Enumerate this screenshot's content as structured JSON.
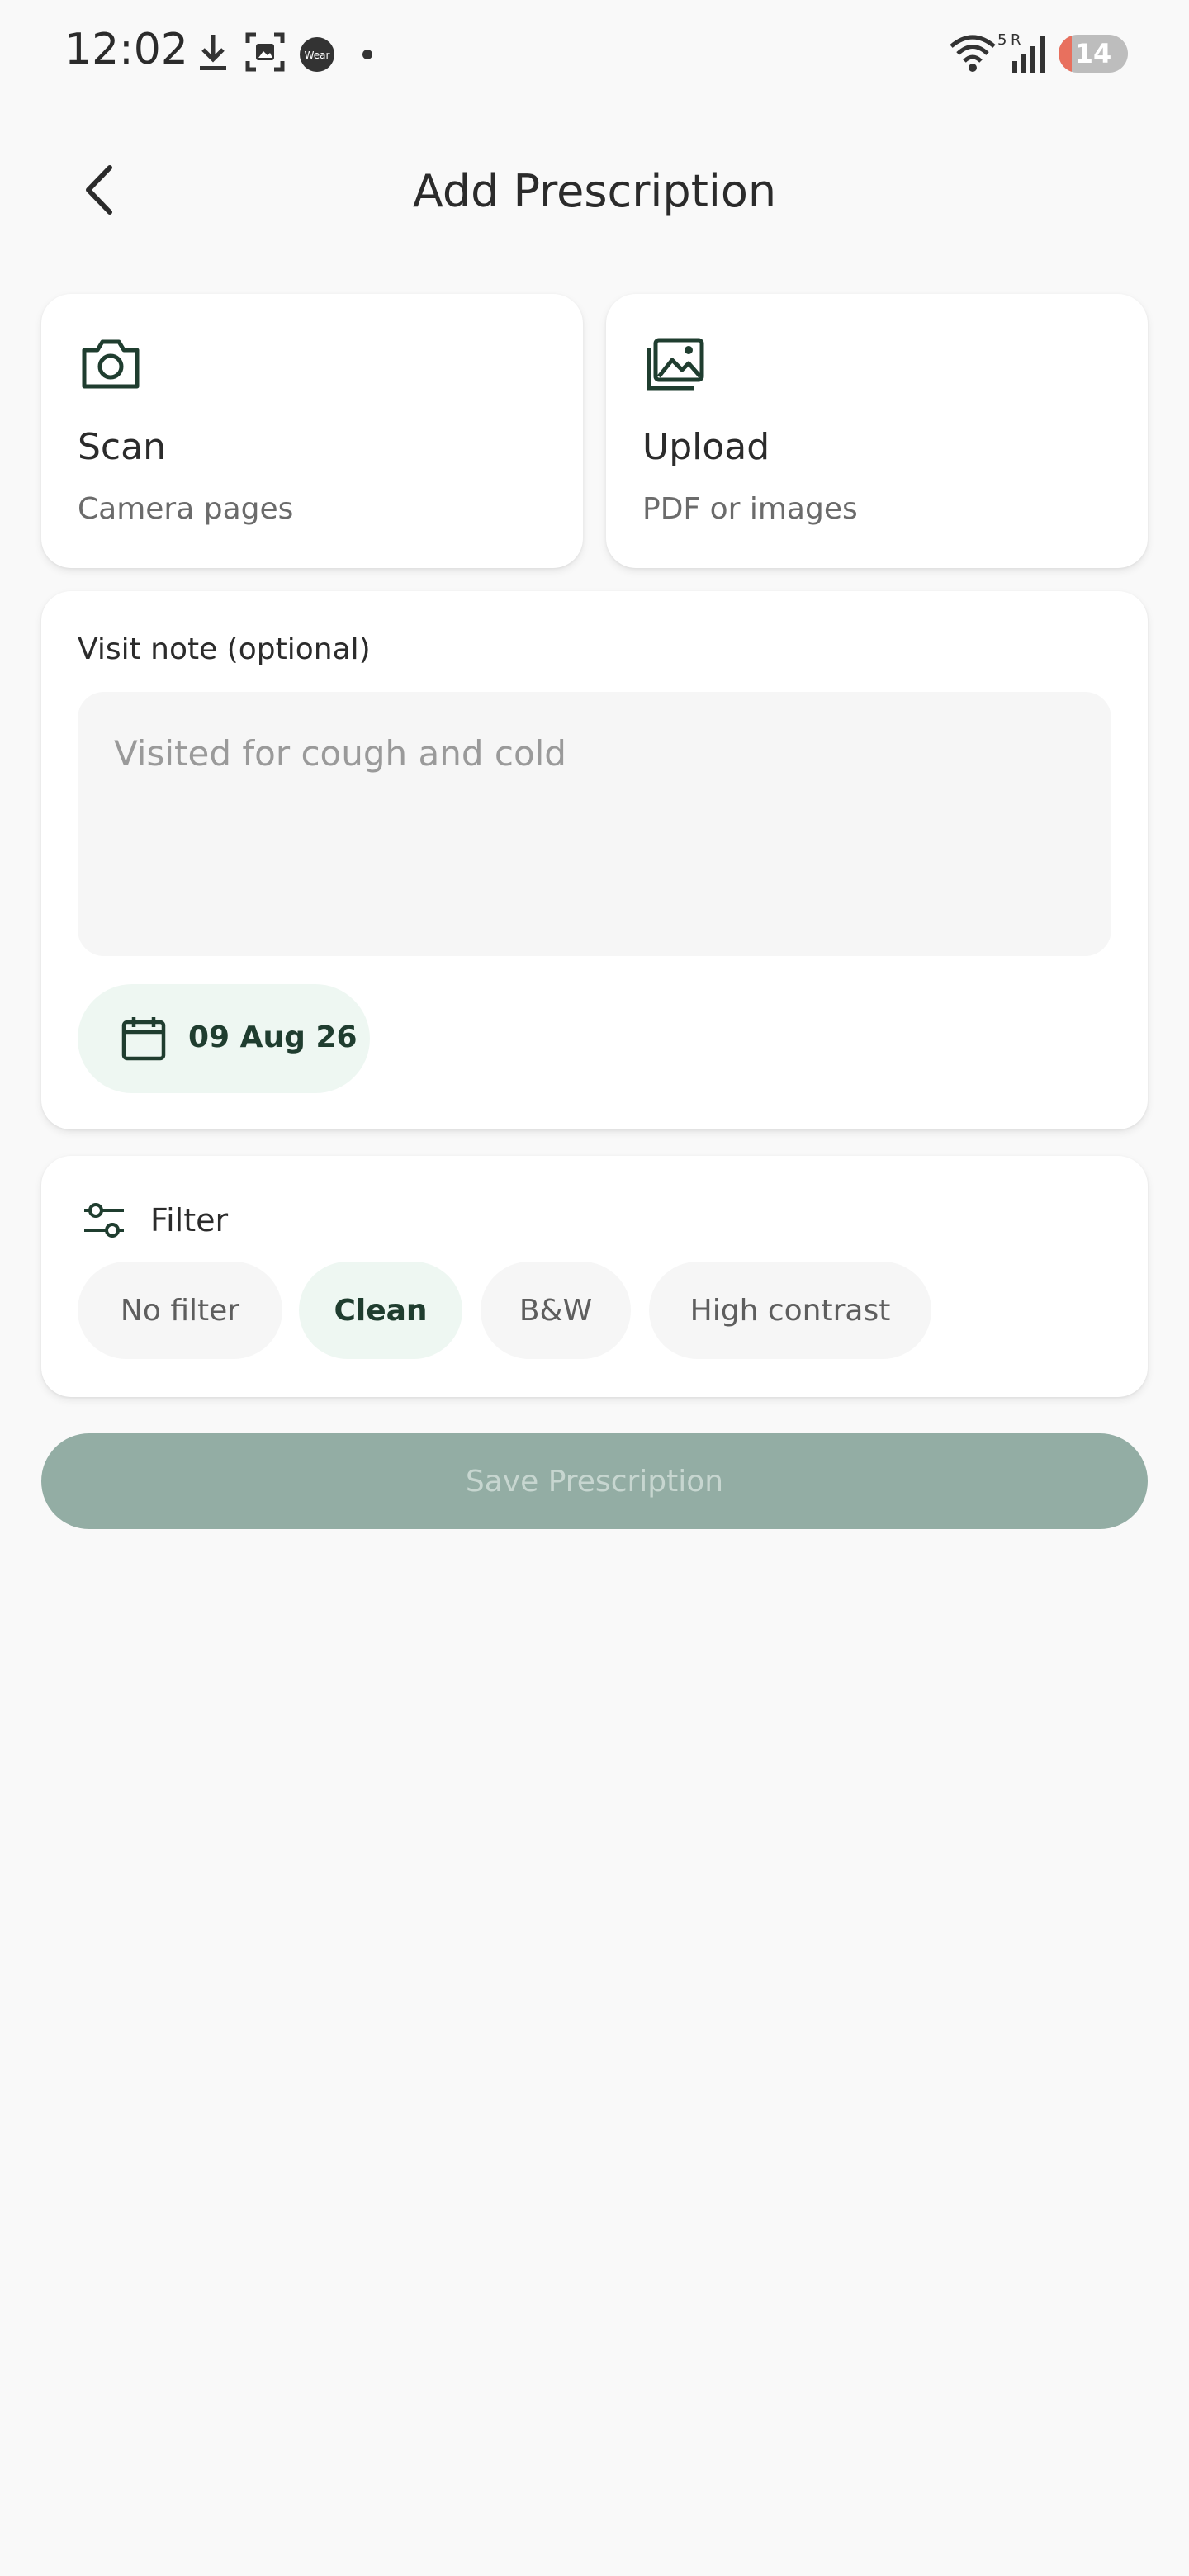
{
  "status_bar": {
    "time": "12:02",
    "icons": [
      "download-icon",
      "screenshot-icon",
      "wear-icon",
      "dot-icon",
      "wifi-icon",
      "signal-icon",
      "battery-icon"
    ],
    "wear_label": "Wear",
    "wifi_label": "5",
    "roaming_label": "R",
    "battery": "14"
  },
  "header": {
    "title": "Add Prescription",
    "back_icon": "back-arrow-icon"
  },
  "sources": [
    {
      "title": "Scan",
      "subtitle": "Camera pages",
      "icon": "camera-icon"
    },
    {
      "title": "Upload",
      "subtitle": "PDF or images",
      "icon": "gallery-icon"
    }
  ],
  "note": {
    "label": "Visit note (optional)",
    "placeholder": "Visited for cough and cold",
    "value": "",
    "date": "09 Aug 26",
    "date_icon": "calendar-icon"
  },
  "filter": {
    "label": "Filter",
    "icon": "sliders-icon",
    "options": [
      "No filter",
      "Clean",
      "B&W",
      "High contrast"
    ],
    "selected": "Clean"
  },
  "actions": {
    "save_label": "Save Prescription",
    "save_enabled": false
  },
  "colors": {
    "accent": "#1f3d2f",
    "chip_selected_bg": "#eef7f2",
    "disabled_button": "#93ada4",
    "background": "#f9f9f9"
  }
}
